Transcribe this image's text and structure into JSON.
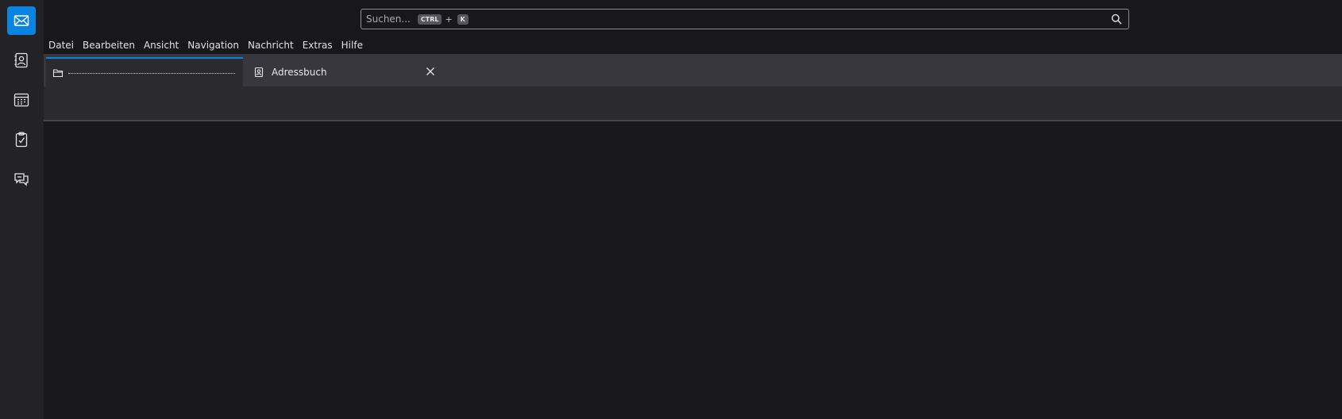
{
  "spaces": {
    "mail": "mail-icon",
    "addressbook": "addressbook-icon",
    "calendar": "calendar-icon",
    "tasks": "tasks-icon",
    "chat": "chat-icon"
  },
  "search": {
    "placeholder": "Suchen...",
    "shortcut_modifier": "CTRL",
    "shortcut_plus": "+",
    "shortcut_key": "K"
  },
  "menubar": {
    "items": [
      "Datei",
      "Bearbeiten",
      "Ansicht",
      "Navigation",
      "Nachricht",
      "Extras",
      "Hilfe"
    ]
  },
  "tabs": [
    {
      "icon": "folder-icon",
      "label": ""
    },
    {
      "icon": "addressbook-icon",
      "label": "Adressbuch"
    }
  ],
  "colors": {
    "accent": "#0a84e0",
    "background": "#18171c",
    "spaces_bar": "#232326",
    "tabstrip": "#38373d"
  }
}
